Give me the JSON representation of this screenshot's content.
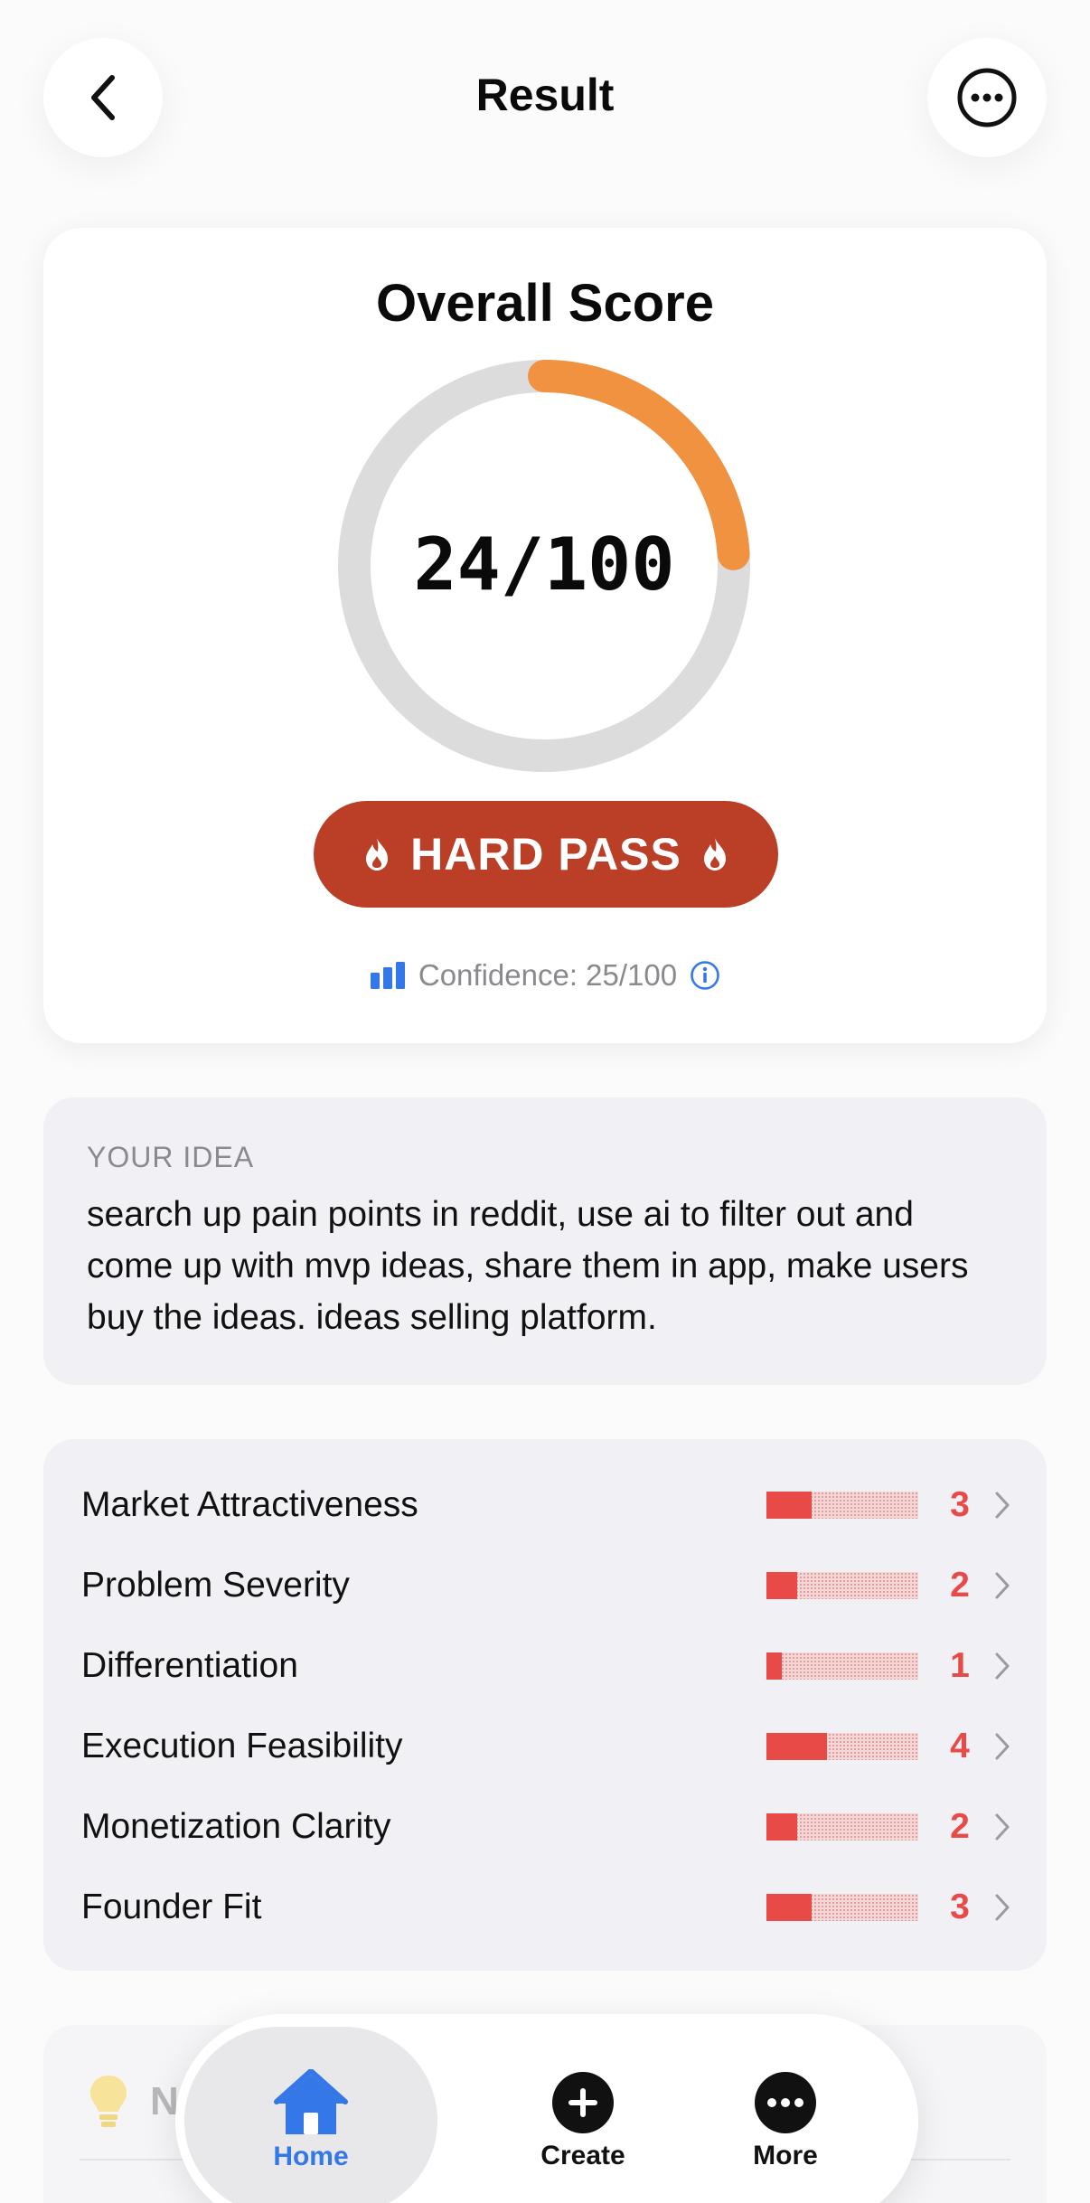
{
  "header": {
    "title": "Result"
  },
  "score": {
    "title": "Overall Score",
    "value_text": "24/100",
    "value": 24,
    "max": 100,
    "gauge_color": "#f09240",
    "track_color": "#dcdcdc",
    "verdict": "HARD PASS",
    "verdict_color": "#bb3e26",
    "confidence_text": "Confidence: 25/100"
  },
  "idea": {
    "label": "YOUR IDEA",
    "text": "search up pain points in reddit, use ai to filter out and come up with mvp ideas, share them in app, make users buy the ideas. ideas selling platform."
  },
  "metrics": [
    {
      "name": "Market Attractiveness",
      "value": 3,
      "max": 10
    },
    {
      "name": "Problem Severity",
      "value": 2,
      "max": 10
    },
    {
      "name": "Differentiation",
      "value": 1,
      "max": 10
    },
    {
      "name": "Execution Feasibility",
      "value": 4,
      "max": 10
    },
    {
      "name": "Monetization Clarity",
      "value": 2,
      "max": 10
    },
    {
      "name": "Founder Fit",
      "value": 3,
      "max": 10
    }
  ],
  "next": {
    "label": "N"
  },
  "tabbar": {
    "home": "Home",
    "create": "Create",
    "more": "More",
    "active_color": "#3477e6"
  }
}
